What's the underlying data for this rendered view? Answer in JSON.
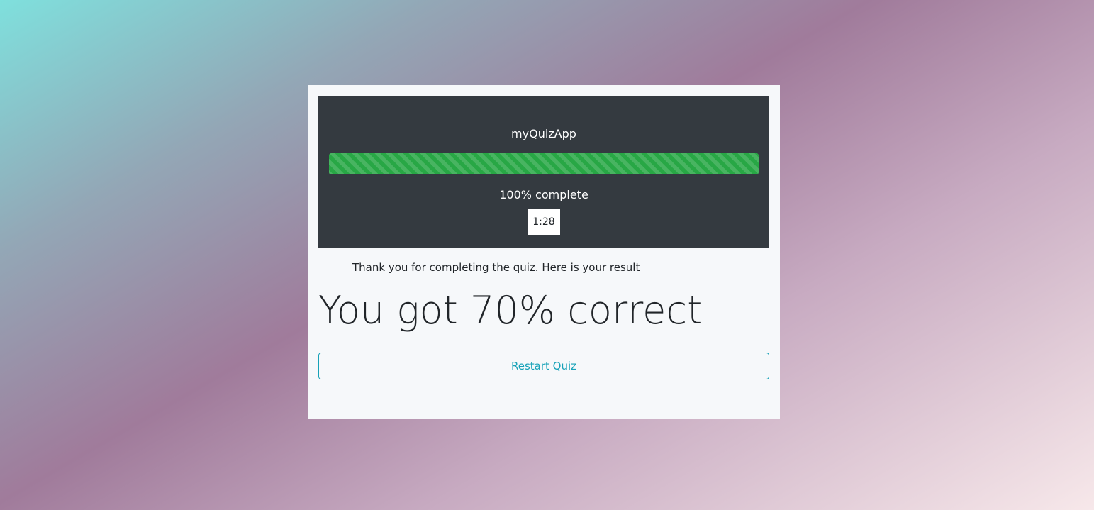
{
  "app": {
    "title": "myQuizApp"
  },
  "progress": {
    "percent": 100,
    "label": "100% complete",
    "color": "#28a745"
  },
  "timer": {
    "value": "1:28"
  },
  "result": {
    "thanks_text": "Thank you for completing the quiz. Here is your result",
    "score_text": "You got 70% correct"
  },
  "actions": {
    "restart_label": "Restart Quiz",
    "restart_color": "#17a2b8"
  }
}
